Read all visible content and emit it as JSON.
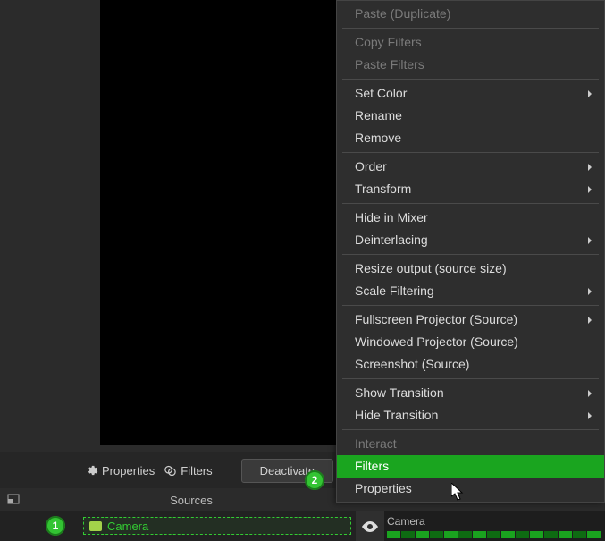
{
  "toolbar": {
    "properties": "Properties",
    "filters": "Filters",
    "deactivate": "Deactivate"
  },
  "panel": {
    "title": "Sources",
    "source_name": "Camera"
  },
  "track": {
    "label": "Camera"
  },
  "badges": {
    "one": "1",
    "two": "2"
  },
  "menu": {
    "paste_dup": "Paste (Duplicate)",
    "copy_filters": "Copy Filters",
    "paste_filters": "Paste Filters",
    "set_color": "Set Color",
    "rename": "Rename",
    "remove": "Remove",
    "order": "Order",
    "transform": "Transform",
    "hide_mixer": "Hide in Mixer",
    "deinterlacing": "Deinterlacing",
    "resize_output": "Resize output (source size)",
    "scale_filtering": "Scale Filtering",
    "fullscreen_proj": "Fullscreen Projector (Source)",
    "windowed_proj": "Windowed Projector (Source)",
    "screenshot": "Screenshot (Source)",
    "show_transition": "Show Transition",
    "hide_transition": "Hide Transition",
    "interact": "Interact",
    "filters": "Filters",
    "properties": "Properties"
  }
}
